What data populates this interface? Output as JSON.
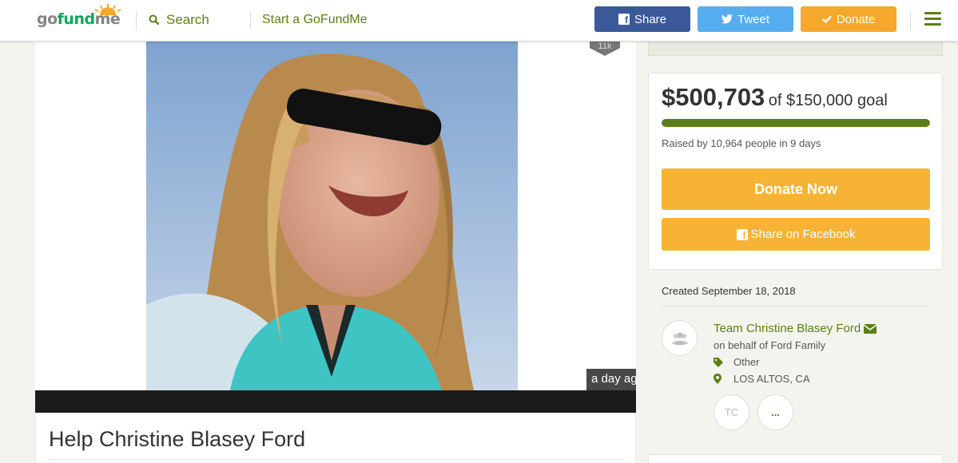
{
  "header": {
    "logo": {
      "go": "go",
      "fund": "fund",
      "me": "me"
    },
    "search_label": "Search",
    "start_label": "Start a GoFundMe",
    "share_label": "Share",
    "tweet_label": "Tweet",
    "donate_label": "Donate",
    "colors": {
      "share": "#3b5998",
      "tweet": "#55acee",
      "donate": "#f6a82d",
      "accent": "#5b7f16"
    }
  },
  "media": {
    "heart_count": "11k",
    "time_badge": "a day ag"
  },
  "campaign": {
    "title": "Help Christine Blasey Ford"
  },
  "progress": {
    "raised_amount": "$500,703",
    "goal_text": "of $150,000 goal",
    "fraction": 1.0,
    "raised_by": "Raised by 10,964 people in 9 days",
    "donate_now_label": "Donate Now",
    "share_facebook_label": "Share on Facebook"
  },
  "details": {
    "created": "Created September 18, 2018",
    "organizer": "Team Christine Blasey Ford",
    "on_behalf": "on behalf of Ford Family",
    "category": "Other",
    "location": "LOS ALTOS, CA",
    "initials": "TC",
    "more": "..."
  },
  "icons": [
    "search-icon",
    "facebook-icon",
    "twitter-icon",
    "check-icon",
    "menu-icon",
    "envelope-icon",
    "tag-icon",
    "map-marker-icon",
    "users-icon"
  ]
}
